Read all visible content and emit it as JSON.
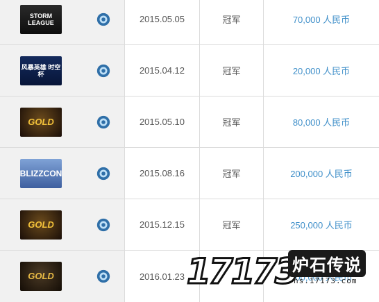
{
  "rows": [
    {
      "logo_text": "STORM LEAGUE",
      "date": "2015.05.05",
      "place": "冠军",
      "prize": "70,000 人民币"
    },
    {
      "logo_text": "风暴英雄 时空杯",
      "date": "2015.04.12",
      "place": "冠军",
      "prize": "20,000 人民币"
    },
    {
      "logo_text": "GOLD",
      "date": "2015.05.10",
      "place": "冠军",
      "prize": "80,000 人民币"
    },
    {
      "logo_text": "BLIZZCON",
      "date": "2015.08.16",
      "place": "冠军",
      "prize": "200,000 人民币"
    },
    {
      "logo_text": "GOLD",
      "date": "2015.12.15",
      "place": "冠军",
      "prize": "250,000 人民币"
    },
    {
      "logo_text": "GOLD",
      "date": "2016.01.23",
      "place": "",
      "prize": "300,000 人民币"
    }
  ],
  "watermark": {
    "number": "17173",
    "title": "炉石传说",
    "url": "hs.17173.com"
  }
}
